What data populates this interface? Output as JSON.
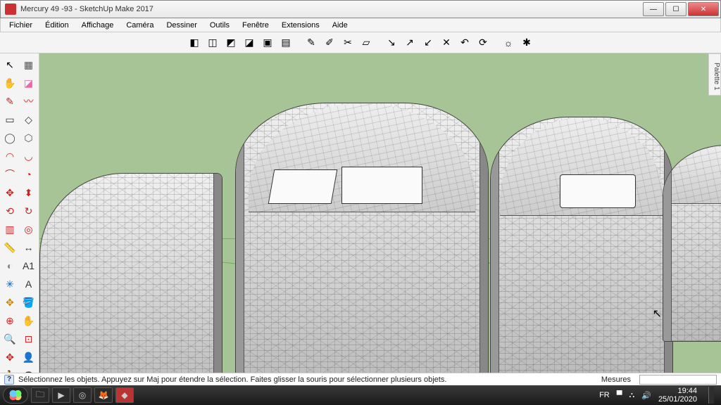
{
  "window": {
    "title": "Mercury 49 -93 - SketchUp Make 2017"
  },
  "menu": {
    "items": [
      "Fichier",
      "Édition",
      "Affichage",
      "Caméra",
      "Dessiner",
      "Outils",
      "Fenêtre",
      "Extensions",
      "Aide"
    ]
  },
  "top_toolbar": {
    "groups": [
      [
        "cube-solid",
        "cube-wire",
        "cube-shaded",
        "cube-texture",
        "cube-mono",
        "cube-xray"
      ],
      [
        "brush-red",
        "brush-orange",
        "brush-cut",
        "eraser"
      ],
      [
        "arrow-red",
        "arrow-orange",
        "arrow-green",
        "arrow-cut",
        "arrow-undo",
        "arrow-rotate"
      ],
      [
        "sun",
        "gear"
      ]
    ],
    "glyphs": {
      "cube-solid": "◧",
      "cube-wire": "◫",
      "cube-shaded": "◩",
      "cube-texture": "◪",
      "cube-mono": "▣",
      "cube-xray": "▤",
      "brush-red": "✎",
      "brush-orange": "✐",
      "brush-cut": "✂",
      "eraser": "▱",
      "arrow-red": "↘",
      "arrow-orange": "↗",
      "arrow-green": "↙",
      "arrow-cut": "✕",
      "arrow-undo": "↶",
      "arrow-rotate": "⟳",
      "sun": "☼",
      "gear": "✱"
    }
  },
  "left_toolbar": {
    "tools": [
      {
        "name": "select",
        "glyph": "↖",
        "color": "#000"
      },
      {
        "name": "lasso",
        "glyph": "▦",
        "color": "#555"
      },
      {
        "name": "hand",
        "glyph": "✋",
        "color": "#c96"
      },
      {
        "name": "eraser",
        "glyph": "◪",
        "color": "#e6a"
      },
      {
        "name": "pencil",
        "glyph": "✎",
        "color": "#c22"
      },
      {
        "name": "freehand",
        "glyph": "〰",
        "color": "#c22"
      },
      {
        "name": "rect",
        "glyph": "▭",
        "color": "#333"
      },
      {
        "name": "rotrect",
        "glyph": "◇",
        "color": "#333"
      },
      {
        "name": "circle",
        "glyph": "◯",
        "color": "#555"
      },
      {
        "name": "polygon",
        "glyph": "⬡",
        "color": "#555"
      },
      {
        "name": "arc",
        "glyph": "◠",
        "color": "#c22"
      },
      {
        "name": "arc2",
        "glyph": "◡",
        "color": "#c22"
      },
      {
        "name": "arc3",
        "glyph": "⌒",
        "color": "#c22"
      },
      {
        "name": "pie",
        "glyph": "◔",
        "color": "#c22"
      },
      {
        "name": "move",
        "glyph": "✥",
        "color": "#c22"
      },
      {
        "name": "pushpull",
        "glyph": "⬍",
        "color": "#c22"
      },
      {
        "name": "rotate",
        "glyph": "⟲",
        "color": "#c22"
      },
      {
        "name": "followme",
        "glyph": "↻",
        "color": "#c22"
      },
      {
        "name": "scale",
        "glyph": "▥",
        "color": "#c22"
      },
      {
        "name": "offset",
        "glyph": "◎",
        "color": "#c22"
      },
      {
        "name": "tape",
        "glyph": "📏",
        "color": "#aa0"
      },
      {
        "name": "dimension",
        "glyph": "↔",
        "color": "#333"
      },
      {
        "name": "protractor",
        "glyph": "◐",
        "color": "#888"
      },
      {
        "name": "text",
        "glyph": "A1",
        "color": "#333"
      },
      {
        "name": "axes",
        "glyph": "✳",
        "color": "#06c"
      },
      {
        "name": "3dtext",
        "glyph": "A",
        "color": "#333"
      },
      {
        "name": "section",
        "glyph": "✥",
        "color": "#c80"
      },
      {
        "name": "paint",
        "glyph": "🪣",
        "color": "#c22"
      },
      {
        "name": "orbit",
        "glyph": "⊕",
        "color": "#c22"
      },
      {
        "name": "pan",
        "glyph": "✋",
        "color": "#c22"
      },
      {
        "name": "zoom",
        "glyph": "🔍",
        "color": "#06c"
      },
      {
        "name": "zoomwin",
        "glyph": "⊡",
        "color": "#c22"
      },
      {
        "name": "zoomext",
        "glyph": "✥",
        "color": "#c22"
      },
      {
        "name": "position",
        "glyph": "👤",
        "color": "#888"
      },
      {
        "name": "walk",
        "glyph": "🚶",
        "color": "#888"
      },
      {
        "name": "look",
        "glyph": "👁",
        "color": "#333"
      }
    ]
  },
  "palette_tab": {
    "label": "Palette 1"
  },
  "status": {
    "help_glyph": "?",
    "hint": "Sélectionnez les objets. Appuyez sur Maj pour étendre la sélection. Faites glisser la souris pour sélectionner plusieurs objets.",
    "measure_label": "Mesures",
    "measure_value": ""
  },
  "taskbar": {
    "icons": [
      "start",
      "explorer",
      "media",
      "chrome",
      "firefox",
      "sketchup"
    ],
    "glyphs": {
      "explorer": "🗀",
      "media": "▶",
      "chrome": "◎",
      "firefox": "🦊",
      "sketchup": "◆"
    },
    "tray": {
      "lang": "FR",
      "flag_glyph": "▀",
      "net_glyph": "⛬",
      "vol_glyph": "🔊",
      "time": "19:44",
      "date": "25/01/2020"
    }
  }
}
